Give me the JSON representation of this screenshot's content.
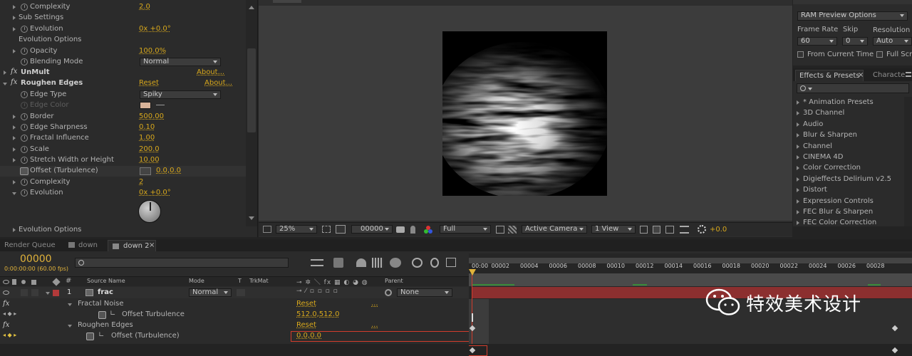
{
  "effect_controls": {
    "rows": [
      {
        "label": "Complexity",
        "value": "2.0"
      },
      {
        "label": "Sub Settings"
      },
      {
        "label": "Evolution",
        "value": "0x +0.0°"
      },
      {
        "label": "Evolution Options"
      },
      {
        "label": "Opacity",
        "value": "100.0%"
      },
      {
        "label": "Blending Mode",
        "value": "Normal"
      },
      {
        "label": "UnMult",
        "link": "About..."
      },
      {
        "label": "Roughen Edges",
        "reset": "Reset",
        "link": "About..."
      },
      {
        "label": "Edge Type",
        "value": "Spiky"
      },
      {
        "label": "Edge Color"
      },
      {
        "label": "Border",
        "value": "500.00"
      },
      {
        "label": "Edge Sharpness",
        "value": "0.10"
      },
      {
        "label": "Fractal Influence",
        "value": "1.00"
      },
      {
        "label": "Scale",
        "value": "200.0"
      },
      {
        "label": "Stretch Width or Height",
        "value": "10.00"
      },
      {
        "label": "Offset (Turbulence)",
        "value": "0.0,0.0"
      },
      {
        "label": "Complexity",
        "value": "2"
      },
      {
        "label": "Evolution",
        "value": "0x +0.0°"
      },
      {
        "label": "Evolution Options"
      }
    ],
    "edge_color_hex": "#d9b49a"
  },
  "viewer": {
    "zoom": "25%",
    "timecode": "00000",
    "resolution": "Full",
    "camera": "Active Camera",
    "views": "1 View",
    "exposure": "+0.0"
  },
  "ram_preview": {
    "title": "RAM Preview Options",
    "frame_rate_label": "Frame Rate",
    "frame_rate": "60",
    "skip_label": "Skip",
    "skip": "0",
    "resolution_label": "Resolution",
    "resolution": "Auto",
    "from_current": "From Current Time",
    "full_screen": "Full Scre"
  },
  "effects_presets": {
    "tab1": "Effects & Presets",
    "tab2": "Characte",
    "items": [
      "* Animation Presets",
      "3D Channel",
      "Audio",
      "Blur & Sharpen",
      "Channel",
      "CINEMA 4D",
      "Color Correction",
      "Digieffects Delirium v2.5",
      "Distort",
      "Expression Controls",
      "FEC Blur & Sharpen",
      "FEC Color Correction"
    ]
  },
  "timeline": {
    "tabs": [
      "Render Queue",
      "down",
      "down 2"
    ],
    "timecode": "00000",
    "timecode_sub": "0:00:00:00 (60.00 fps)",
    "col_source": "Source Name",
    "col_mode": "Mode",
    "col_t": "T",
    "col_trkmat": "TrkMat",
    "col_parent": "Parent",
    "ruler": [
      "00:00",
      "00002",
      "00004",
      "00006",
      "00008",
      "00010",
      "00012",
      "00014",
      "00016",
      "00018",
      "00020",
      "00022",
      "00024",
      "00026",
      "00028"
    ],
    "layer": {
      "num": "1",
      "name": "frac",
      "mode": "Normal",
      "parent": "None"
    },
    "sub": [
      {
        "fx": "fx",
        "name": "Fractal Noise",
        "value": "Reset",
        "extra": "..."
      },
      {
        "name": "Offset Turbulence",
        "value": "512.0,512.0"
      },
      {
        "fx": "fx",
        "name": "Roughen Edges",
        "value": "Reset",
        "extra": "..."
      },
      {
        "name": "Offset (Turbulence)",
        "value": "0.0,0.0"
      }
    ]
  },
  "watermark": {
    "text": "特效美术设计"
  }
}
